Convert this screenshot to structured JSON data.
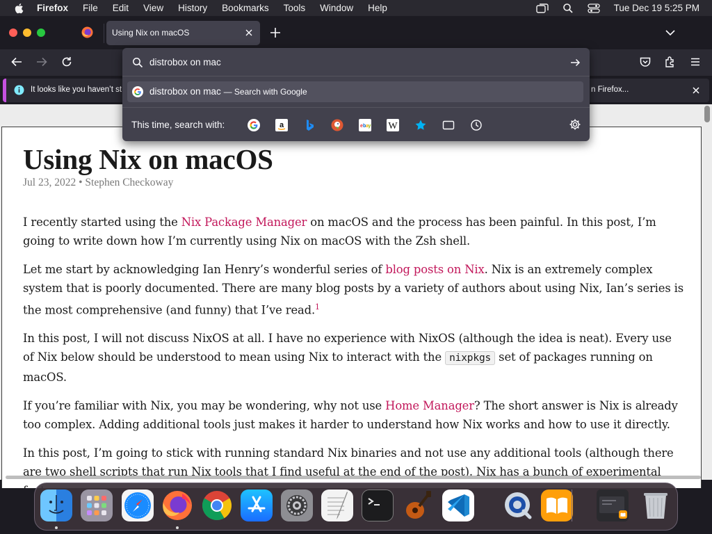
{
  "menubar": {
    "app_name": "Firefox",
    "items": [
      "File",
      "Edit",
      "View",
      "History",
      "Bookmarks",
      "Tools",
      "Window",
      "Help"
    ],
    "datetime": "Tue Dec 19  5:25 PM"
  },
  "tab": {
    "title": "Using Nix on macOS"
  },
  "urlbar": {
    "query": "distrobox on mac",
    "suggestion_text": "distrobox on mac",
    "suggestion_suffix": "— Search with Google",
    "oneoff_label": "This time, search with:",
    "engines": [
      "google-icon",
      "amazon-icon",
      "bing-icon",
      "duckduckgo-icon",
      "ebay-icon",
      "wikipedia-icon",
      "bookmarks-icon",
      "tabs-icon",
      "history-icon"
    ]
  },
  "notification": {
    "text_start": "It looks like you haven’t st",
    "text_end": "n Firefox..."
  },
  "article": {
    "title": "Using Nix on macOS",
    "meta": "Jul 23, 2022 • Stephen Checkoway",
    "p1_a": "I recently started using the ",
    "p1_link": "Nix Package Manager",
    "p1_b": " on macOS and the process has been painful. In this post, I’m going to write down how I’m currently using Nix on macOS with the Zsh shell.",
    "p2_a": "Let me start by acknowledging Ian Henry’s wonderful series of ",
    "p2_link": "blog posts on Nix",
    "p2_b": ". Nix is an extremely complex system that is poorly documented. There are many blog posts by a variety of authors about using Nix, Ian’s series is the most comprehensive (and funny) that I’ve read.",
    "p2_sup": "1",
    "p3_a": "In this post, I will not discuss NixOS at all. I have no experience with NixOS (although the idea is neat). Every use of Nix below should be understood to mean using Nix to interact with the ",
    "p3_code": "nixpkgs",
    "p3_b": " set of packages running on macOS.",
    "p4_a": "If you’re familiar with Nix, you may be wondering, why not use ",
    "p4_link": "Home Manager",
    "p4_b": "? The short answer is Nix is already too complex. Adding additional tools just makes it harder to understand how Nix works and how to use it directly.",
    "p5": "In this post, I’m going to stick with running standard Nix binaries and not use any additional tools (although there are two shell scripts that run Nix tools that I find useful at the end of the post). Nix has a bunch of experimental features"
  },
  "dock": {
    "apps": [
      "finder",
      "launchpad",
      "safari",
      "firefox",
      "chrome",
      "app-store",
      "system-settings",
      "textedit",
      "terminal",
      "garageband",
      "vscode",
      "quicktime",
      "books",
      "recent-window",
      "trash"
    ]
  },
  "colors": {
    "accent_link": "#c2185b",
    "notification_bar": "#c651e0",
    "panel_bg": "#42414d"
  }
}
